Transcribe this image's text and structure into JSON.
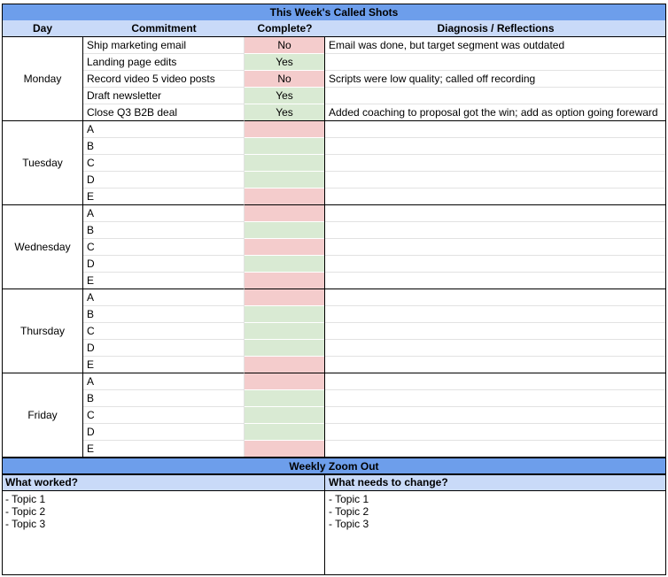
{
  "title": "This Week's Called Shots",
  "headers": {
    "day": "Day",
    "commitment": "Commitment",
    "complete": "Complete?",
    "reflections": "Diagnosis / Reflections"
  },
  "days": [
    {
      "name": "Monday",
      "rows": [
        {
          "commitment": "Ship marketing email",
          "complete": "No",
          "status": "no",
          "reflection": "Email was done, but target segment was outdated"
        },
        {
          "commitment": "Landing page edits",
          "complete": "Yes",
          "status": "yes",
          "reflection": ""
        },
        {
          "commitment": "Record video 5 video posts",
          "complete": "No",
          "status": "no",
          "reflection": "Scripts were low quality; called off recording"
        },
        {
          "commitment": "Draft newsletter",
          "complete": "Yes",
          "status": "yes",
          "reflection": ""
        },
        {
          "commitment": "Close Q3 B2B deal",
          "complete": "Yes",
          "status": "yes",
          "reflection": "Added coaching to proposal got the win; add as option going foreward"
        }
      ]
    },
    {
      "name": "Tuesday",
      "rows": [
        {
          "commitment": "A",
          "complete": "",
          "status": "no",
          "reflection": ""
        },
        {
          "commitment": "B",
          "complete": "",
          "status": "yes",
          "reflection": ""
        },
        {
          "commitment": "C",
          "complete": "",
          "status": "yes",
          "reflection": ""
        },
        {
          "commitment": "D",
          "complete": "",
          "status": "yes",
          "reflection": ""
        },
        {
          "commitment": "E",
          "complete": "",
          "status": "no",
          "reflection": ""
        }
      ]
    },
    {
      "name": "Wednesday",
      "rows": [
        {
          "commitment": "A",
          "complete": "",
          "status": "no",
          "reflection": ""
        },
        {
          "commitment": "B",
          "complete": "",
          "status": "yes",
          "reflection": ""
        },
        {
          "commitment": "C",
          "complete": "",
          "status": "no",
          "reflection": ""
        },
        {
          "commitment": "D",
          "complete": "",
          "status": "yes",
          "reflection": ""
        },
        {
          "commitment": "E",
          "complete": "",
          "status": "no",
          "reflection": ""
        }
      ]
    },
    {
      "name": "Thursday",
      "rows": [
        {
          "commitment": "A",
          "complete": "",
          "status": "no",
          "reflection": ""
        },
        {
          "commitment": "B",
          "complete": "",
          "status": "yes",
          "reflection": ""
        },
        {
          "commitment": "C",
          "complete": "",
          "status": "yes",
          "reflection": ""
        },
        {
          "commitment": "D",
          "complete": "",
          "status": "yes",
          "reflection": ""
        },
        {
          "commitment": "E",
          "complete": "",
          "status": "no",
          "reflection": ""
        }
      ]
    },
    {
      "name": "Friday",
      "rows": [
        {
          "commitment": "A",
          "complete": "",
          "status": "no",
          "reflection": ""
        },
        {
          "commitment": "B",
          "complete": "",
          "status": "yes",
          "reflection": ""
        },
        {
          "commitment": "C",
          "complete": "",
          "status": "yes",
          "reflection": ""
        },
        {
          "commitment": "D",
          "complete": "",
          "status": "yes",
          "reflection": ""
        },
        {
          "commitment": "E",
          "complete": "",
          "status": "no",
          "reflection": ""
        }
      ]
    }
  ],
  "zoom": {
    "title": "Weekly Zoom Out",
    "worked_label": "What worked?",
    "change_label": "What needs to change?",
    "worked_topics": [
      "- Topic 1",
      "- Topic 2",
      "- Topic 3"
    ],
    "change_topics": [
      "- Topic 1",
      "- Topic 2",
      "- Topic 3"
    ]
  },
  "colors": {
    "title_bg": "#6d9eeb",
    "header_bg": "#c9daf8",
    "yes_bg": "#d9ead3",
    "no_bg": "#f4cccc"
  }
}
